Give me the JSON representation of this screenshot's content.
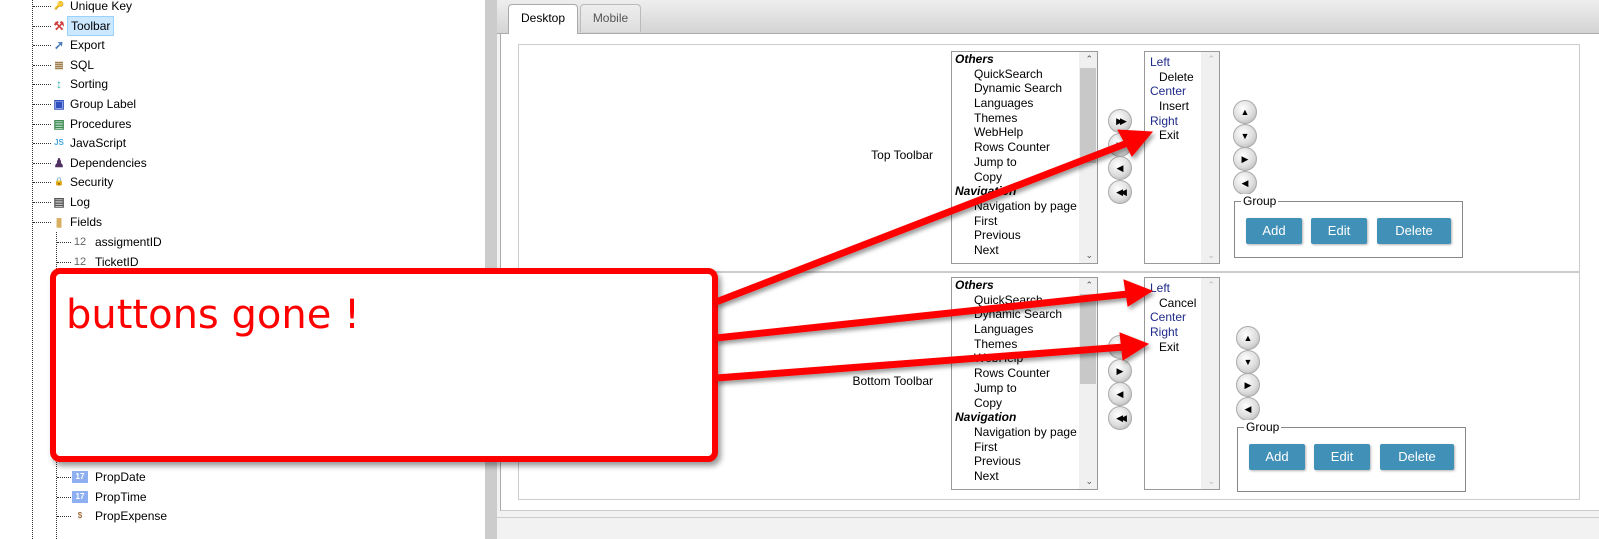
{
  "tree": {
    "items": [
      {
        "label": "Unique Key",
        "icon": "key-icon"
      },
      {
        "label": "Toolbar",
        "icon": "toolbar-icon",
        "selected": true
      },
      {
        "label": "Export",
        "icon": "export-icon"
      },
      {
        "label": "SQL",
        "icon": "sql-icon"
      },
      {
        "label": "Sorting",
        "icon": "sorting-icon"
      },
      {
        "label": "Group Label",
        "icon": "group-label-icon"
      },
      {
        "label": "Procedures",
        "icon": "procedures-icon"
      },
      {
        "label": "JavaScript",
        "icon": "javascript-icon"
      },
      {
        "label": "Dependencies",
        "icon": "dependencies-icon"
      },
      {
        "label": "Security",
        "icon": "lock-icon"
      },
      {
        "label": "Log",
        "icon": "log-icon"
      },
      {
        "label": "Fields",
        "icon": "folder-icon"
      }
    ],
    "fields": [
      {
        "label": "assigmentID",
        "type": "12"
      },
      {
        "label": "TicketID",
        "type": "12"
      }
    ],
    "fields_bottom": [
      {
        "label": "PropDate",
        "type": "17"
      },
      {
        "label": "PropTime",
        "type": "17"
      },
      {
        "label": "PropExpense",
        "type": "$"
      }
    ]
  },
  "tabs": [
    {
      "label": "Desktop",
      "active": true
    },
    {
      "label": "Mobile",
      "active": false
    }
  ],
  "available_items": [
    {
      "label": "Others",
      "group": true
    },
    {
      "label": "QuickSearch"
    },
    {
      "label": "Dynamic Search"
    },
    {
      "label": "Languages"
    },
    {
      "label": "Themes"
    },
    {
      "label": "WebHelp"
    },
    {
      "label": "Rows Counter"
    },
    {
      "label": "Jump to"
    },
    {
      "label": "Copy"
    },
    {
      "label": "Navigation",
      "group": true
    },
    {
      "label": "Navigation by page"
    },
    {
      "label": "First"
    },
    {
      "label": "Previous"
    },
    {
      "label": "Next"
    }
  ],
  "top_toolbar": {
    "label": "Top Toolbar",
    "selected": [
      {
        "label": "Left",
        "pos": true
      },
      {
        "label": "Delete"
      },
      {
        "label": "Center",
        "pos": true
      },
      {
        "label": "Insert"
      },
      {
        "label": "Right",
        "pos": true
      },
      {
        "label": "Exit"
      }
    ]
  },
  "bottom_toolbar": {
    "label": "Bottom Toolbar",
    "selected": [
      {
        "label": "Left",
        "pos": true
      },
      {
        "label": "Cancel"
      },
      {
        "label": "Center",
        "pos": true
      },
      {
        "label": "Right",
        "pos": true
      },
      {
        "label": "Exit"
      }
    ]
  },
  "group": {
    "legend": "Group",
    "add": "Add",
    "edit": "Edit",
    "delete": "Delete"
  },
  "annotation": {
    "text": "buttons gone !",
    "color": "#ff0000"
  },
  "colors": {
    "button": "#4190b8",
    "position_label": "#1f2a8a",
    "selection": "#cce8ff"
  }
}
